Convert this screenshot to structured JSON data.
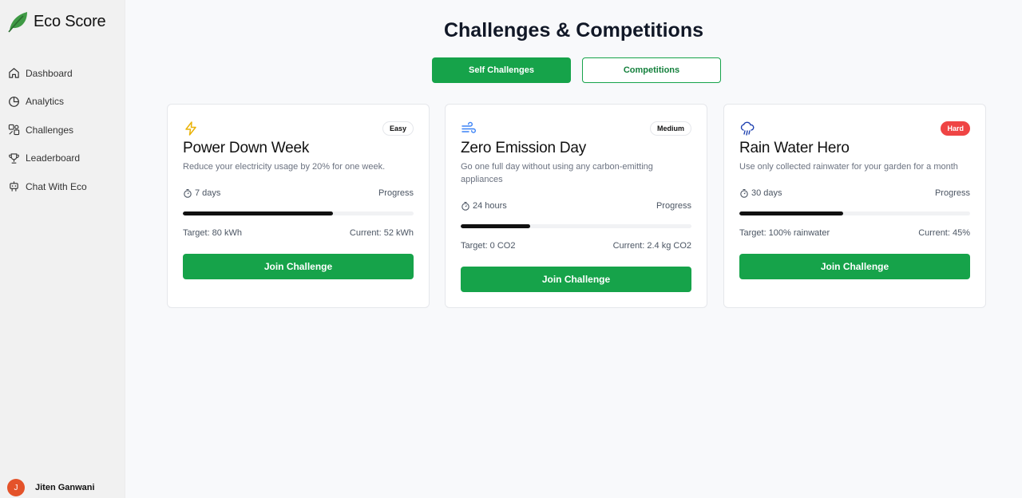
{
  "app": {
    "name": "Eco Score"
  },
  "sidebar": {
    "items": [
      {
        "label": "Dashboard",
        "icon": "home-icon"
      },
      {
        "label": "Analytics",
        "icon": "pie-chart-icon"
      },
      {
        "label": "Challenges",
        "icon": "puzzle-icon"
      },
      {
        "label": "Leaderboard",
        "icon": "trophy-icon"
      },
      {
        "label": "Chat With Eco",
        "icon": "bot-icon"
      }
    ]
  },
  "user": {
    "initial": "J",
    "name": "Jiten Ganwani"
  },
  "page": {
    "title": "Challenges & Competitions"
  },
  "tabs": [
    {
      "label": "Self Challenges",
      "active": true
    },
    {
      "label": "Competitions",
      "active": false
    }
  ],
  "colors": {
    "accent": "#16a34a",
    "hard": "#ef4444",
    "easy_icon": "#eab308",
    "medium_icon": "#3b82f6",
    "hard_icon": "#1e40af"
  },
  "cards": [
    {
      "icon": "lightning-icon",
      "difficulty": "Easy",
      "title": "Power Down Week",
      "description": "Reduce your electricity usage by 20% for one week.",
      "duration": "7 days",
      "progress_label": "Progress",
      "progress": 0.65,
      "target": "Target: 80 kWh",
      "current": "Current: 52 kWh",
      "button": "Join Challenge"
    },
    {
      "icon": "wind-icon",
      "difficulty": "Medium",
      "title": "Zero Emission Day",
      "description": "Go one full day without using any carbon-emitting appliances",
      "duration": "24 hours",
      "progress_label": "Progress",
      "progress": 0.3,
      "target": "Target: 0 CO2",
      "current": "Current: 2.4 kg CO2",
      "button": "Join Challenge"
    },
    {
      "icon": "cloud-rain-icon",
      "difficulty": "Hard",
      "title": "Rain Water Hero",
      "description": "Use only collected rainwater for your garden for a month",
      "duration": "30 days",
      "progress_label": "Progress",
      "progress": 0.45,
      "target": "Target: 100% rainwater",
      "current": "Current: 45%",
      "button": "Join Challenge"
    }
  ]
}
